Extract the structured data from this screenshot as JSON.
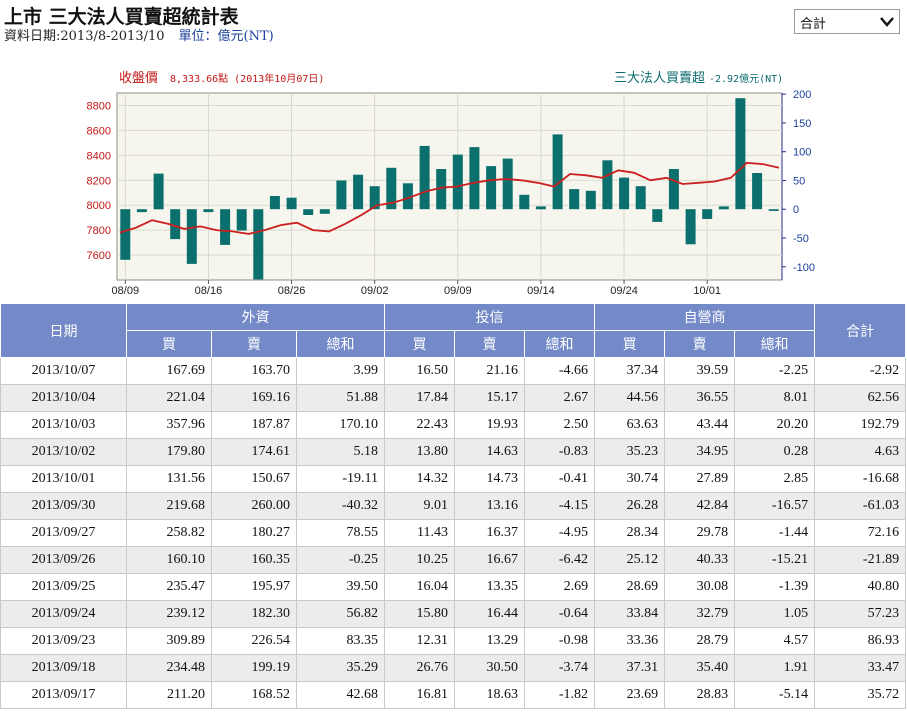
{
  "header": {
    "title": "上市 三大法人買賣超統計表",
    "date_range": "資料日期:2013/8-2013/10",
    "unit": "單位：億元(NT)"
  },
  "selector": {
    "value": "合計"
  },
  "chart_data": {
    "type": "bar+line",
    "left_label": "收盤價",
    "left_info": "8,333.66點 (2013年10月07日)",
    "right_label": "三大法人買賣超",
    "right_info": "-2.92億元(NT)",
    "y_left": {
      "min": 7400,
      "max": 8900,
      "ticks": [
        7600,
        7800,
        8000,
        8200,
        8400,
        8600,
        8800
      ]
    },
    "y_right": {
      "min": -123,
      "max": 202,
      "ticks": [
        -100,
        -50,
        0,
        50,
        100,
        150,
        200
      ]
    },
    "x_tick_labels": [
      "08/09",
      "08/16",
      "08/26",
      "09/02",
      "09/09",
      "09/14",
      "09/24",
      "10/01"
    ],
    "x_tick_index": [
      0,
      5,
      10,
      15,
      20,
      25,
      30,
      35
    ],
    "bars": [
      -88,
      -5,
      62,
      -52,
      -95,
      -5,
      -62,
      -37,
      -122,
      23,
      20,
      -10,
      -8,
      50,
      60,
      40,
      72,
      45,
      110,
      70,
      95,
      108,
      75,
      88,
      25,
      5,
      130,
      35,
      32,
      85,
      55,
      40,
      -22,
      70,
      -61,
      -17,
      5,
      193,
      63,
      -3
    ],
    "close": [
      7780,
      7820,
      7880,
      7850,
      7810,
      7830,
      7800,
      7790,
      7770,
      7800,
      7840,
      7860,
      7800,
      7790,
      7850,
      7920,
      8000,
      8020,
      8060,
      8110,
      8140,
      8150,
      8180,
      8200,
      8210,
      8200,
      8180,
      8150,
      8250,
      8240,
      8220,
      8280,
      8260,
      8200,
      8220,
      8170,
      8180,
      8190,
      8220,
      8340,
      8330,
      8300
    ]
  },
  "table": {
    "headers": {
      "date": "日期",
      "foreign": "外資",
      "trust": "投信",
      "dealer": "自營商",
      "total": "合計",
      "buy": "買",
      "sell": "賣",
      "net": "總和"
    },
    "rows": [
      [
        "2013/10/07",
        "167.69",
        "163.70",
        "3.99",
        "16.50",
        "21.16",
        "-4.66",
        "37.34",
        "39.59",
        "-2.25",
        "-2.92"
      ],
      [
        "2013/10/04",
        "221.04",
        "169.16",
        "51.88",
        "17.84",
        "15.17",
        "2.67",
        "44.56",
        "36.55",
        "8.01",
        "62.56"
      ],
      [
        "2013/10/03",
        "357.96",
        "187.87",
        "170.10",
        "22.43",
        "19.93",
        "2.50",
        "63.63",
        "43.44",
        "20.20",
        "192.79"
      ],
      [
        "2013/10/02",
        "179.80",
        "174.61",
        "5.18",
        "13.80",
        "14.63",
        "-0.83",
        "35.23",
        "34.95",
        "0.28",
        "4.63"
      ],
      [
        "2013/10/01",
        "131.56",
        "150.67",
        "-19.11",
        "14.32",
        "14.73",
        "-0.41",
        "30.74",
        "27.89",
        "2.85",
        "-16.68"
      ],
      [
        "2013/09/30",
        "219.68",
        "260.00",
        "-40.32",
        "9.01",
        "13.16",
        "-4.15",
        "26.28",
        "42.84",
        "-16.57",
        "-61.03"
      ],
      [
        "2013/09/27",
        "258.82",
        "180.27",
        "78.55",
        "11.43",
        "16.37",
        "-4.95",
        "28.34",
        "29.78",
        "-1.44",
        "72.16"
      ],
      [
        "2013/09/26",
        "160.10",
        "160.35",
        "-0.25",
        "10.25",
        "16.67",
        "-6.42",
        "25.12",
        "40.33",
        "-15.21",
        "-21.89"
      ],
      [
        "2013/09/25",
        "235.47",
        "195.97",
        "39.50",
        "16.04",
        "13.35",
        "2.69",
        "28.69",
        "30.08",
        "-1.39",
        "40.80"
      ],
      [
        "2013/09/24",
        "239.12",
        "182.30",
        "56.82",
        "15.80",
        "16.44",
        "-0.64",
        "33.84",
        "32.79",
        "1.05",
        "57.23"
      ],
      [
        "2013/09/23",
        "309.89",
        "226.54",
        "83.35",
        "12.31",
        "13.29",
        "-0.98",
        "33.36",
        "28.79",
        "4.57",
        "86.93"
      ],
      [
        "2013/09/18",
        "234.48",
        "199.19",
        "35.29",
        "26.76",
        "30.50",
        "-3.74",
        "37.31",
        "35.40",
        "1.91",
        "33.47"
      ],
      [
        "2013/09/17",
        "211.20",
        "168.52",
        "42.68",
        "16.81",
        "18.63",
        "-1.82",
        "23.69",
        "28.83",
        "-5.14",
        "35.72"
      ]
    ]
  }
}
